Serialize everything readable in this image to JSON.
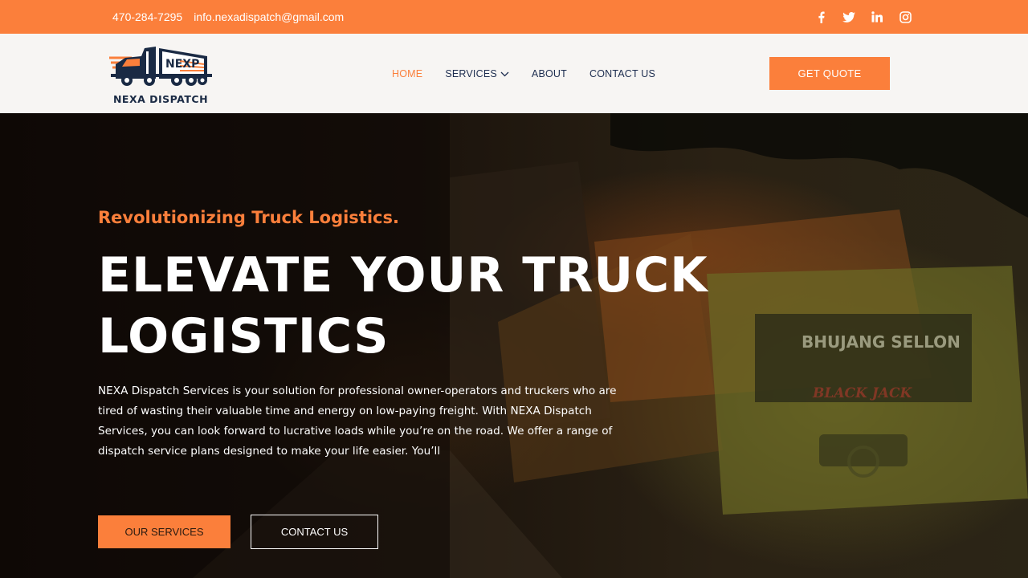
{
  "topbar": {
    "phone": "470-284-7295",
    "email": "info.nexadispatch@gmail.com",
    "social": [
      "facebook-icon",
      "twitter-icon",
      "linkedin-icon",
      "instagram-icon"
    ]
  },
  "brand": {
    "name": "NEXA DISPATCH",
    "logo_mark": "NEXP"
  },
  "nav": {
    "items": [
      {
        "label": "HOME",
        "active": true
      },
      {
        "label": "SERVICES",
        "has_dropdown": true
      },
      {
        "label": "ABOUT"
      },
      {
        "label": "CONTACT US"
      }
    ],
    "cta": "GET QUOTE"
  },
  "hero": {
    "tagline": "Revolutionizing Truck Logistics.",
    "headline_line1": "ELEVATE YOUR TRUCK",
    "headline_line2": "LOGISTICS",
    "description": "NEXA Dispatch Services is your solution for professional owner-operators and truckers who are tired of wasting their valuable time and energy on low-paying freight. With NEXA Dispatch Services, you can look forward to lucrative loads while you’re on the road. We offer a range of dispatch service plans designed to make your life easier. You’ll",
    "primary_button": "OUR SERVICES",
    "secondary_button": "CONTACT US",
    "truck_text_1": "BHUJANG SELLON",
    "truck_text_2": "BLACK JACK"
  },
  "colors": {
    "accent": "#fb7f3b",
    "nav_text": "#1d2d4f",
    "header_bg": "#f7f5f3"
  }
}
